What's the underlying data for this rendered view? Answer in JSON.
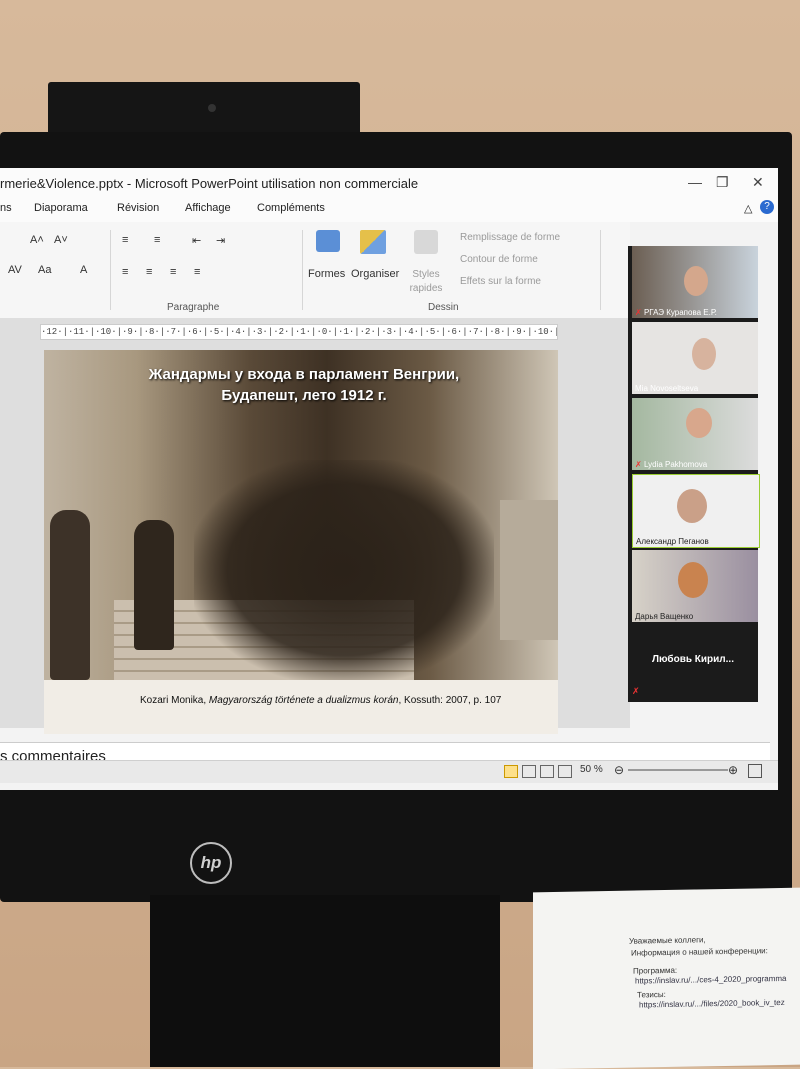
{
  "window": {
    "title": "rmerie&Violence.pptx - Microsoft PowerPoint utilisation non commerciale"
  },
  "menu": [
    "ns",
    "Diaporama",
    "Révision",
    "Affichage",
    "Compléments"
  ],
  "ribbon": {
    "formes": "Formes",
    "organiser": "Organiser",
    "styles": "Styles rapides",
    "remplissage": "Remplissage de forme",
    "contour": "Contour de forme",
    "effets": "Effets sur la forme",
    "paragraphe": "Paragraphe",
    "dessin": "Dessin"
  },
  "ruler": "·12·|·11·|·10·|·9·|·8·|·7·|·6·|·5·|·4·|·3·|·2·|·1·|·0·|·1·|·2·|·3·|·4·|·5·|·6·|·7·|·8·|·9·|·10·|·11·|·12·",
  "slide": {
    "title_line1": "Жандармы у входа в парламент Венгрии,",
    "title_line2": "Будапешт, лето 1912 г.",
    "caption_author": "Kozari Monika, ",
    "caption_book": "Magyarország története a dualizmus korán",
    "caption_rest": ", Kossuth: 2007,  p. 107"
  },
  "notes": "s commentaires",
  "status": {
    "zoom": "50 %"
  },
  "participants": [
    {
      "name": "РГАЭ Курапова Е.Р.",
      "muted": true
    },
    {
      "name": "Mia Novoseltseva",
      "muted": false
    },
    {
      "name": "Lydia Pakhomova",
      "muted": true
    },
    {
      "name": "Александр Пеганов",
      "muted": false
    },
    {
      "name": "Дарья Ващенко",
      "muted": false
    }
  ],
  "big_participant": "Любовь Кирил...",
  "brand": "hp",
  "paper": {
    "line1": "Уважаемые коллеги,",
    "line2": "Информация о нашей конференции:",
    "line3": "Программа:",
    "line4": "https://inslav.ru/.../ces-4_2020_programma",
    "line5": "Тезисы:",
    "line6": "https://inslav.ru/.../files/2020_book_iv_tez"
  }
}
